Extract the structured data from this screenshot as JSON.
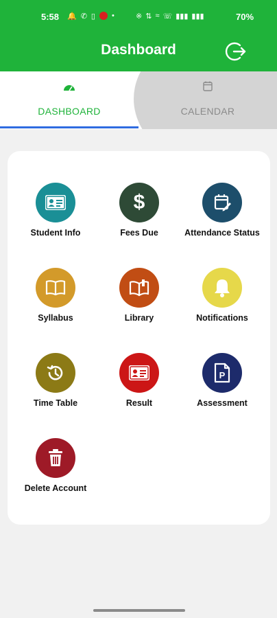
{
  "status_bar": {
    "time": "5:58",
    "battery": "70%",
    "left_icons": [
      "notification-bell-icon",
      "whatsapp-icon",
      "sim-icon",
      "jio-icon",
      "dot-icon"
    ],
    "right_icons": [
      "bluetooth-icon",
      "data-speed-icon",
      "wifi-icon",
      "wifi-calling-icon",
      "signal-icon",
      "signal-icon"
    ]
  },
  "app_bar": {
    "title": "Dashboard",
    "logout_icon": "logout-icon"
  },
  "tabs": [
    {
      "label": "DASHBOARD",
      "icon": "speedometer-icon",
      "selected": true
    },
    {
      "label": "CALENDAR",
      "icon": "calendar-icon",
      "selected": false
    }
  ],
  "colors": {
    "primary": "#1fb33a",
    "tab_indicator": "#2f6ce0",
    "student_info": "#1a8f96",
    "fees_due": "#2e4a36",
    "attendance": "#1d4e6b",
    "syllabus": "#d39a2a",
    "library": "#c14d14",
    "notifications": "#e6d84a",
    "time_table": "#8c7a16",
    "result": "#cc1616",
    "assessment": "#1d2b6b",
    "delete_account": "#9e1a27"
  },
  "tiles": [
    {
      "label": "Student Info",
      "icon": "id-card-icon"
    },
    {
      "label": "Fees Due",
      "icon": "dollar-icon"
    },
    {
      "label": "Attendance Status",
      "icon": "calendar-edit-icon"
    },
    {
      "label": "Syllabus",
      "icon": "book-icon"
    },
    {
      "label": "Library",
      "icon": "book-open-icon"
    },
    {
      "label": "Notifications",
      "icon": "bell-icon"
    },
    {
      "label": "Time Table",
      "icon": "history-icon"
    },
    {
      "label": "Result",
      "icon": "report-card-icon"
    },
    {
      "label": "Assessment",
      "icon": "assessment-doc-icon"
    },
    {
      "label": "Delete Account",
      "icon": "trash-icon"
    }
  ]
}
